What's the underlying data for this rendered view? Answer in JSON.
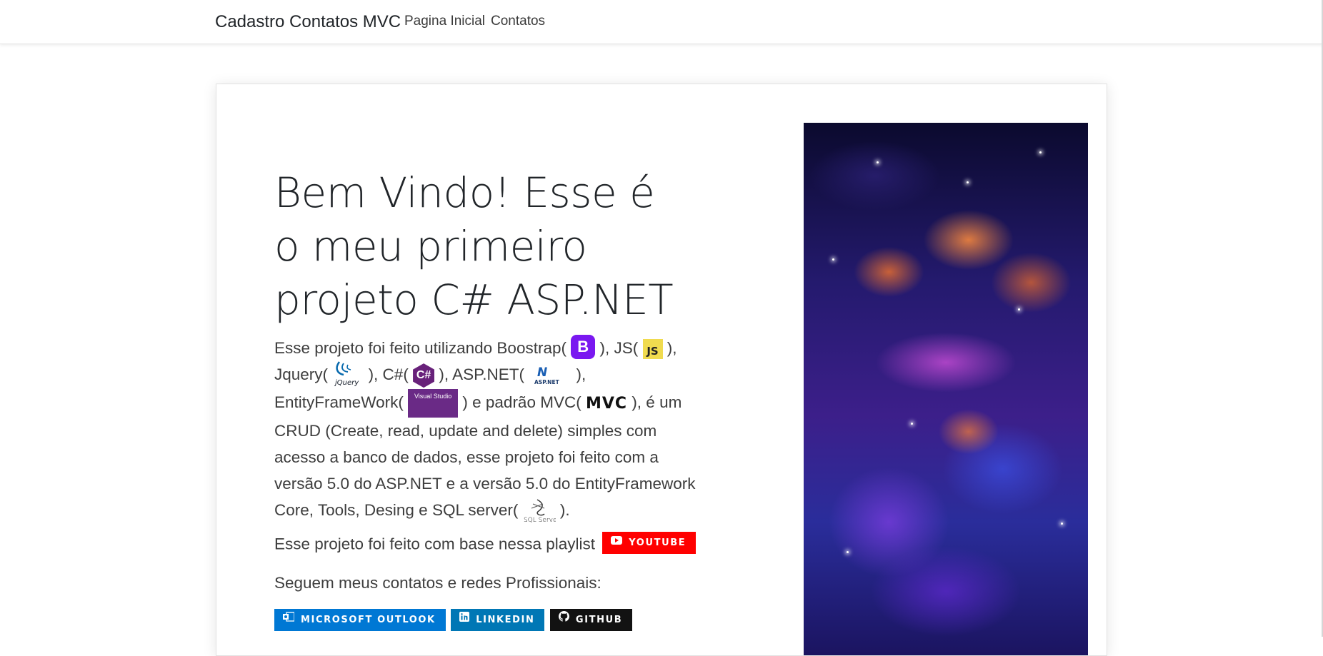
{
  "navbar": {
    "brand": "Cadastro Contatos MVC",
    "links": [
      "Pagina Inicial",
      "Contatos"
    ]
  },
  "main": {
    "heading": "Bem Vindo! Esse é o meu primeiro projeto C# ASP.NET",
    "lead": {
      "t1": "Esse projeto foi feito utilizando Boostrap(",
      "t2": "), JS(",
      "t3": "), Jquery(",
      "t4": "), C#(",
      "t5": "), ASP.NET(",
      "t6": "), EntityFrameWork(",
      "t7": ") e padrão MVC(",
      "t8": "), é um CRUD (Create, read, update and delete) simples com acesso a banco de dados, esse projeto foi feito com a versão 5.0 do ASP.NET e a versão 5.0 do EntityFramework Core, Tools, Desing e SQL server(",
      "t9": ")."
    },
    "icons": {
      "bootstrap": "B",
      "bootstrap_sub": "Bootstrap",
      "js": "JS",
      "jquery": "jQuery",
      "csharp": "C#",
      "aspnet": "ASP.NET",
      "visual_studio": "Visual Studio",
      "mvc": "MVC",
      "sql_server": "SQL Server"
    },
    "playlist_text": "Esse projeto foi feito com base nessa playlist",
    "youtube_label": "YOUTUBE",
    "contacts_text": "Seguem meus contatos e redes Profissionais:",
    "social": {
      "outlook": "MICROSOFT OUTLOOK",
      "linkedin": "LINKEDIN",
      "github": "GITHUB"
    }
  },
  "colors": {
    "youtube": "#ff0000",
    "outlook": "#0078d4",
    "linkedin": "#0077b5",
    "github": "#121212",
    "bootstrap": "#7a18f0"
  }
}
